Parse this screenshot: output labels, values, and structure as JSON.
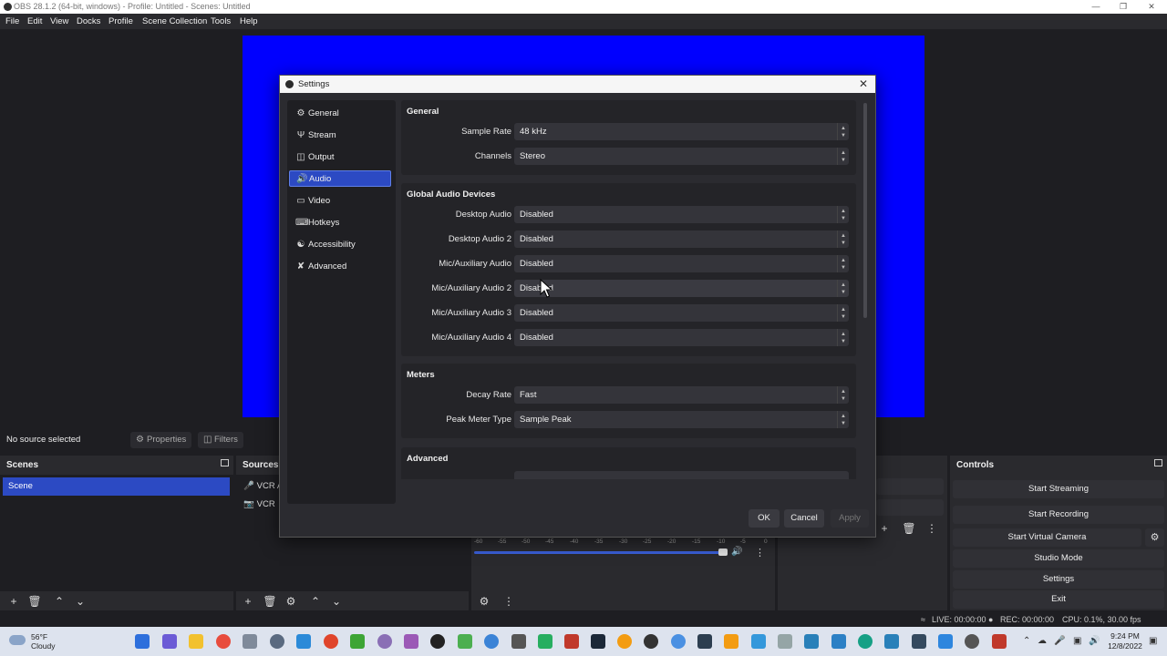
{
  "window": {
    "title": "OBS 28.1.2 (64-bit, windows) - Profile: Untitled - Scenes: Untitled"
  },
  "menu": [
    "File",
    "Edit",
    "View",
    "Docks",
    "Profile",
    "Scene Collection",
    "Tools",
    "Help"
  ],
  "preview": {
    "background_color": "#0000ff"
  },
  "source_bar": {
    "status": "No source selected",
    "properties": "Properties",
    "filters": "Filters"
  },
  "scenes": {
    "title": "Scenes",
    "items": [
      "Scene"
    ]
  },
  "sources": {
    "title": "Sources",
    "items": [
      {
        "label": "VCR A",
        "icon": "microphone-icon"
      },
      {
        "label": "VCR",
        "icon": "camera-icon"
      }
    ]
  },
  "mixer": {
    "ticks": [
      "-60",
      "-55",
      "-50",
      "-45",
      "-40",
      "-35",
      "-30",
      "-25",
      "-20",
      "-15",
      "-10",
      "-5",
      "0"
    ]
  },
  "controls": {
    "title": "Controls",
    "buttons": [
      "Start Streaming",
      "Start Recording",
      "Start Virtual Camera",
      "Studio Mode",
      "Settings",
      "Exit"
    ]
  },
  "status": {
    "live": "LIVE: 00:00:00",
    "rec": "REC: 00:00:00",
    "cpu": "CPU: 0.1%, 30.00 fps"
  },
  "taskbar": {
    "temp": "56°F",
    "weather": "Cloudy",
    "time": "9:24 PM",
    "date": "12/8/2022"
  },
  "settings": {
    "title": "Settings",
    "nav": [
      {
        "label": "General",
        "icon": "gear-icon"
      },
      {
        "label": "Stream",
        "icon": "antenna-icon"
      },
      {
        "label": "Output",
        "icon": "output-icon"
      },
      {
        "label": "Audio",
        "icon": "speaker-icon"
      },
      {
        "label": "Video",
        "icon": "monitor-icon"
      },
      {
        "label": "Hotkeys",
        "icon": "keyboard-icon"
      },
      {
        "label": "Accessibility",
        "icon": "accessibility-icon"
      },
      {
        "label": "Advanced",
        "icon": "tools-icon"
      }
    ],
    "active_nav": "Audio",
    "general": {
      "title": "General",
      "sample_rate": {
        "label": "Sample Rate",
        "value": "48 kHz"
      },
      "channels": {
        "label": "Channels",
        "value": "Stereo"
      }
    },
    "devices": {
      "title": "Global Audio Devices",
      "rows": [
        {
          "label": "Desktop Audio",
          "value": "Disabled"
        },
        {
          "label": "Desktop Audio 2",
          "value": "Disabled"
        },
        {
          "label": "Mic/Auxiliary Audio",
          "value": "Disabled"
        },
        {
          "label": "Mic/Auxiliary Audio 2",
          "value": "Disabled"
        },
        {
          "label": "Mic/Auxiliary Audio 3",
          "value": "Disabled"
        },
        {
          "label": "Mic/Auxiliary Audio 4",
          "value": "Disabled"
        }
      ]
    },
    "meters": {
      "title": "Meters",
      "decay": {
        "label": "Decay Rate",
        "value": "Fast"
      },
      "peak": {
        "label": "Peak Meter Type",
        "value": "Sample Peak"
      }
    },
    "advanced": {
      "title": "Advanced"
    },
    "buttons": {
      "ok": "OK",
      "cancel": "Cancel",
      "apply": "Apply"
    }
  }
}
